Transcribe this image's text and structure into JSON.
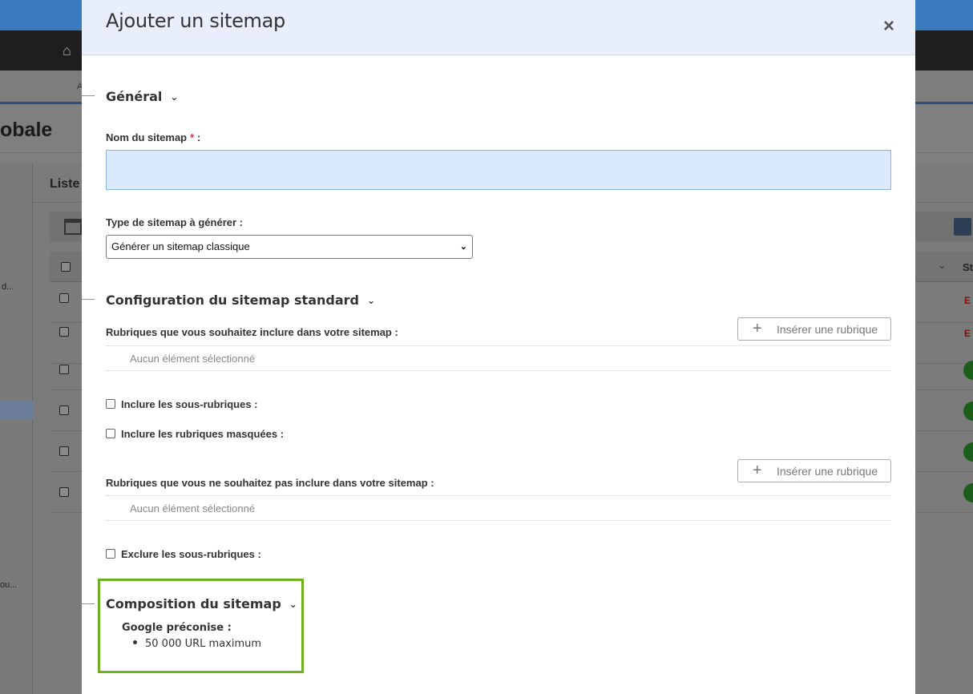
{
  "background": {
    "subnav_letter": "A",
    "page_title": "obale",
    "panel_title": "Liste",
    "side_text_1": "d...",
    "side_text_2": "ou...",
    "col_header": "St",
    "row_status_red": "E"
  },
  "modal": {
    "title": "Ajouter un sitemap",
    "close_label": "×"
  },
  "sections": {
    "general": {
      "title": "Général"
    },
    "config": {
      "title": "Configuration du sitemap standard"
    },
    "composition": {
      "title": "Composition du sitemap"
    }
  },
  "form": {
    "name_label": "Nom du sitemap",
    "name_required": "*",
    "name_suffix": ":",
    "name_value": "",
    "type_label": "Type de sitemap à générer :",
    "type_selected": "Générer un sitemap classique",
    "include_label": "Rubriques que vous souhaitez inclure dans votre sitemap :",
    "insert_button": "Insérer une rubrique",
    "none_selected": "Aucun élément sélectionné",
    "include_sub": "Inclure les sous-rubriques :",
    "include_hidden": "Inclure les rubriques masquées :",
    "exclude_label": "Rubriques que vous ne souhaitez pas inclure dans votre sitemap :",
    "exclude_sub": "Exclure les sous-rubriques :"
  },
  "composition": {
    "subtitle": "Google préconise :",
    "items": [
      "50 000 URL maximum"
    ]
  }
}
